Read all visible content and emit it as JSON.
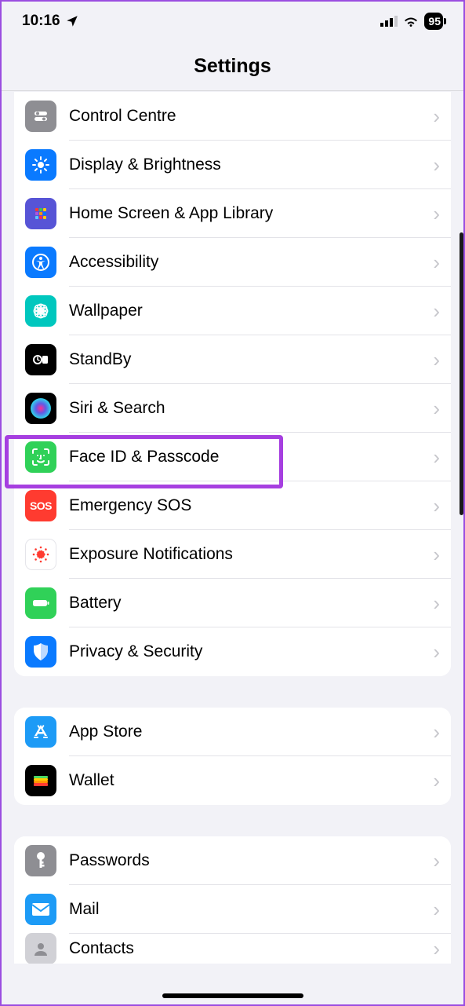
{
  "status_bar": {
    "time": "10:16",
    "battery_percent": "95"
  },
  "header": {
    "title": "Settings"
  },
  "groups": [
    {
      "rows": [
        {
          "id": "control-centre",
          "label": "Control Centre"
        },
        {
          "id": "display",
          "label": "Display & Brightness"
        },
        {
          "id": "home-screen",
          "label": "Home Screen & App Library"
        },
        {
          "id": "accessibility",
          "label": "Accessibility"
        },
        {
          "id": "wallpaper",
          "label": "Wallpaper"
        },
        {
          "id": "standby",
          "label": "StandBy"
        },
        {
          "id": "siri",
          "label": "Siri & Search"
        },
        {
          "id": "faceid",
          "label": "Face ID & Passcode",
          "highlighted": true
        },
        {
          "id": "sos",
          "label": "Emergency SOS"
        },
        {
          "id": "exposure",
          "label": "Exposure Notifications"
        },
        {
          "id": "battery",
          "label": "Battery"
        },
        {
          "id": "privacy",
          "label": "Privacy & Security"
        }
      ]
    },
    {
      "rows": [
        {
          "id": "app-store",
          "label": "App Store"
        },
        {
          "id": "wallet",
          "label": "Wallet"
        }
      ]
    },
    {
      "rows": [
        {
          "id": "passwords",
          "label": "Passwords"
        },
        {
          "id": "mail",
          "label": "Mail"
        },
        {
          "id": "contacts",
          "label": "Contacts"
        }
      ]
    }
  ]
}
